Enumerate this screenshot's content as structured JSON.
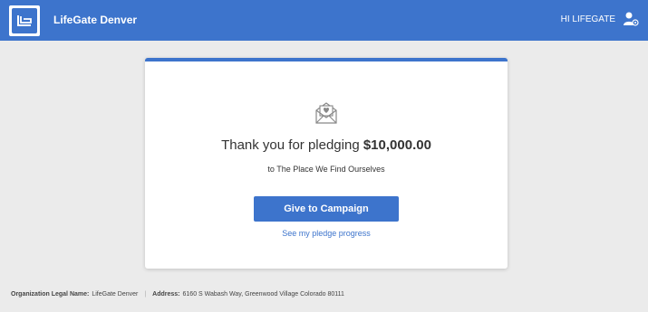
{
  "header": {
    "org_name": "LifeGate Denver",
    "greeting": "HI LIFEGATE",
    "logo_icon": "lifegate-logo",
    "user_icon": "user-settings-icon",
    "brand_color": "#3d74cc"
  },
  "card": {
    "icon": "envelope-heart-icon",
    "thanks_prefix": "Thank you for pledging",
    "amount": "$10,000.00",
    "recipient": "to The Place We Find Ourselves",
    "give_button": "Give to Campaign",
    "progress_link": "See my pledge progress"
  },
  "footer": {
    "legal_name_label": "Organization Legal Name:",
    "legal_name_value": "LifeGate Denver",
    "separator": "|",
    "address_label": "Address:",
    "address_value": "6160 S Wabash Way, Greenwood Village Colorado 80111"
  }
}
